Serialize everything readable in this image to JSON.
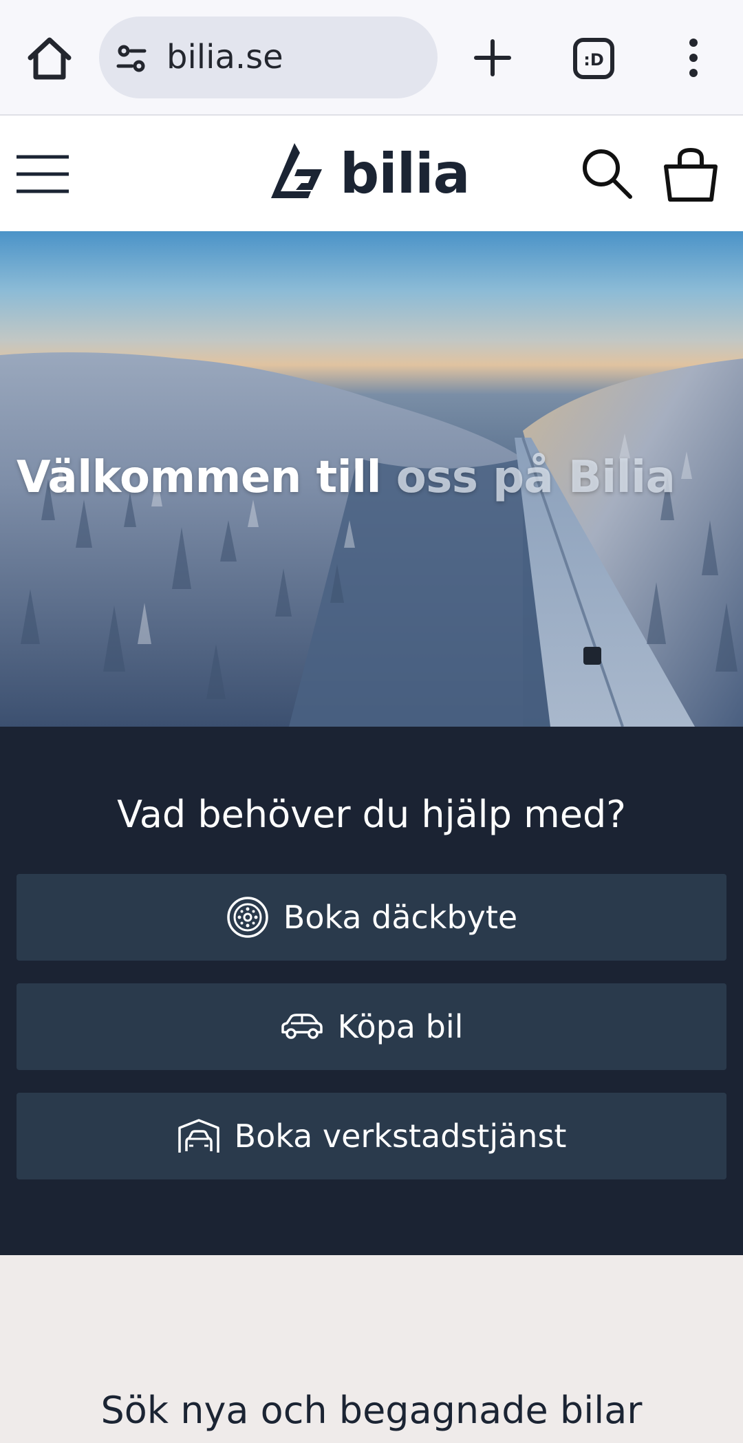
{
  "browser": {
    "url": "bilia.se",
    "icons": [
      "home-icon",
      "site-settings-icon",
      "new-tab-icon",
      "tab-switcher-icon",
      "more-vert-icon"
    ],
    "tabs_badge": ":D"
  },
  "header": {
    "logo_text": "bilia",
    "icons": [
      "hamburger-menu-icon",
      "bilia-logo-mark",
      "search-icon",
      "shopping-bag-icon"
    ]
  },
  "hero": {
    "title_bright": "Välkommen till",
    "title_dim": " oss på Bilia"
  },
  "help": {
    "heading": "Vad behöver du hjälp med?",
    "actions": [
      {
        "label": "Boka däckbyte",
        "icon": "tire-icon"
      },
      {
        "label": "Köpa bil",
        "icon": "car-icon"
      },
      {
        "label": "Boka verkstadstjänst",
        "icon": "garage-icon"
      }
    ]
  },
  "search_section": {
    "heading": "Sök nya och begagnade bilar"
  },
  "colors": {
    "header_dark": "#1b2333",
    "button_bg": "#2a3a4c",
    "logo": "#1b2433",
    "page_bg": "#efebea"
  }
}
